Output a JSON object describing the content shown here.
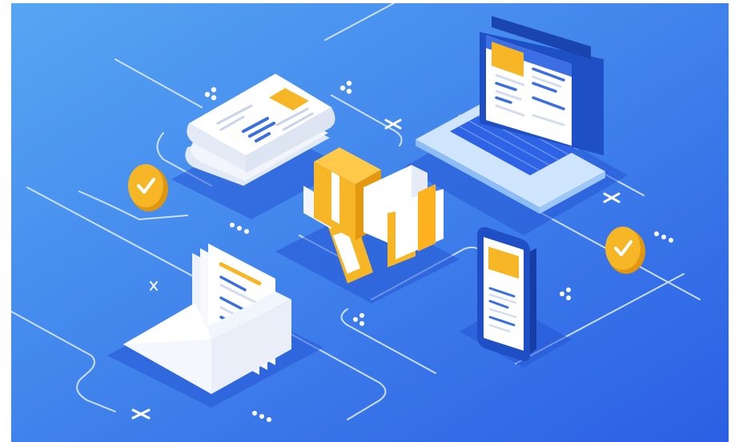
{
  "scene": {
    "kind": "isometric digital marketing illustration",
    "colors": {
      "background_light": "#4f9ef0",
      "background_dark": "#2f63e6",
      "line": "#dbe9ff",
      "accent": "#f6b626",
      "accent_dark": "#e09412",
      "paper": "#ffffff",
      "paper_shade": "#dfe6f4",
      "text_bar": "#3b6fe0",
      "laptop_body": "#b9d9fb",
      "laptop_keys": "#2f63e6"
    },
    "objects": [
      {
        "name": "newspaper",
        "icon": "newspaper-icon"
      },
      {
        "name": "laptop",
        "icon": "laptop-icon"
      },
      {
        "name": "megaphone",
        "icon": "megaphone-icon"
      },
      {
        "name": "smartphone",
        "icon": "smartphone-icon"
      },
      {
        "name": "envelope",
        "icon": "envelope-with-letter-icon"
      },
      {
        "name": "check-coins",
        "icon": "check-circle-icon",
        "count": 2
      }
    ]
  }
}
